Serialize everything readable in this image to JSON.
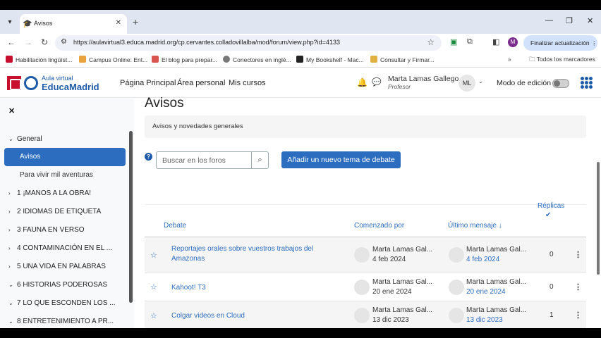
{
  "browser": {
    "tab_title": "Avisos",
    "new_tab": "+",
    "url": "https://aulavirtual3.educa.madrid.org/cp.cervantes.colladovillalba/mod/forum/view.php?id=4133",
    "update_button": "Finalizar actualización",
    "profile_initial": "M",
    "bookmarks": [
      {
        "label": "Habilitación lingüíst..."
      },
      {
        "label": "Campus Online: Ent..."
      },
      {
        "label": "El blog para prepar..."
      },
      {
        "label": "Conectores en inglé..."
      },
      {
        "label": "My Bookshelf - Mac..."
      },
      {
        "label": "Consultar y Firmar..."
      }
    ],
    "bookmarks_more": "»",
    "all_bookmarks": "Todos los marcadores"
  },
  "header": {
    "logo_small": "Aula virtual",
    "logo_big": "EducaMadrid",
    "nav": [
      "Página Principal",
      "Área personal",
      "Mis cursos"
    ],
    "user_name": "Marta Lamas Gallego",
    "user_role": "Profesor",
    "user_initials": "ML",
    "edit_mode_label": "Modo de edición"
  },
  "sidebar": {
    "general": "General",
    "active": "Avisos",
    "sub_item": "Para vivir mil aventuras",
    "sections": [
      "1 ¡MANOS A LA OBRA!",
      "2 IDIOMAS DE ETIQUETA",
      "3 FAUNA EN VERSO",
      "4 CONTAMINACIÓN EN EL ...",
      "5 UNA VIDA EN PALABRAS",
      "6 HISTORIAS PODEROSAS",
      "7 LO QUE ESCONDEN LOS ...",
      "8 ENTRETENIMIENTO A PR..."
    ]
  },
  "main": {
    "title": "Avisos",
    "description": "Avisos y novedades generales",
    "search_placeholder": "Buscar en los foros",
    "add_button": "Añadir un nuevo tema de debate",
    "columns": {
      "debate": "Debate",
      "started_by": "Comenzado por",
      "last_post": "Último mensaje",
      "replies": "Réplicas"
    },
    "rows": [
      {
        "title": "Reportajes orales sobre vuestros trabajos del Amazonas",
        "author": "Marta Lamas Gal...",
        "start_date": "4 feb 2024",
        "last_author": "Marta Lamas Gal...",
        "last_date": "4 feb 2024",
        "replies": "0"
      },
      {
        "title": "Kahoot! T3",
        "author": "Marta Lamas Gal...",
        "start_date": "20 ene 2024",
        "last_author": "Marta Lamas Gal...",
        "last_date": "20 ene 2024",
        "replies": "0"
      },
      {
        "title": "Colgar videos en Cloud",
        "author": "Marta Lamas Gal...",
        "start_date": "13 dic 2023",
        "last_author": "Marta Lamas Gal...",
        "last_date": "13 dic 2023",
        "replies": "1"
      }
    ]
  },
  "colors": {
    "accent": "#2c6dbf",
    "brand_red": "#c8102e"
  }
}
